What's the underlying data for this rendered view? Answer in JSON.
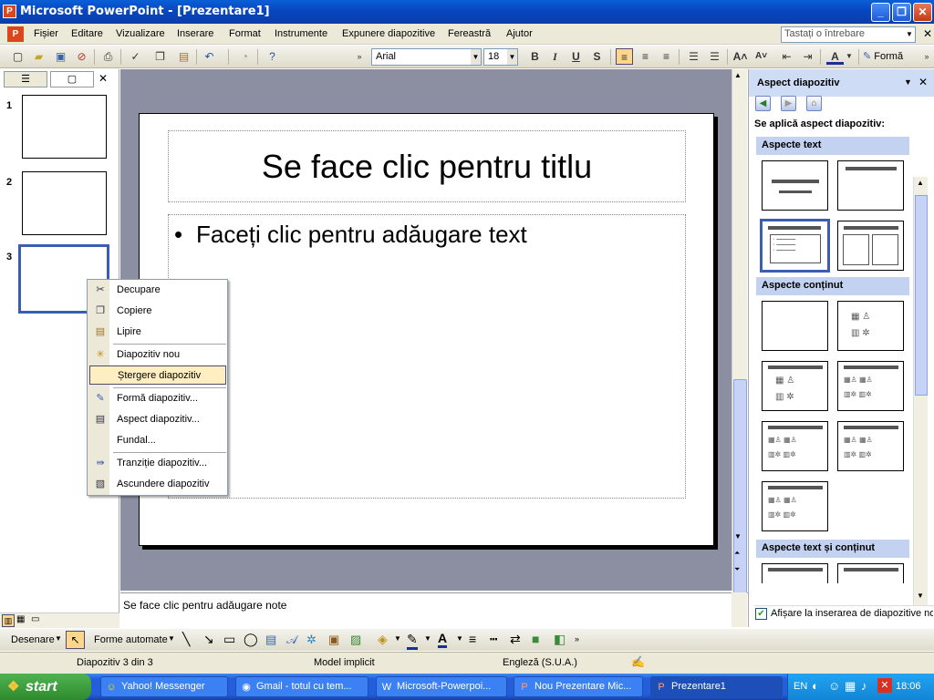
{
  "window": {
    "title": "Microsoft PowerPoint - [Prezentare1]",
    "app_icon": "P"
  },
  "menu": {
    "items": [
      "Fișier",
      "Editare",
      "Vizualizare",
      "Inserare",
      "Format",
      "Instrumente",
      "Expunere diapozitive",
      "Fereastră",
      "Ajutor"
    ],
    "ask_placeholder": "Tastați o întrebare"
  },
  "toolbar": {
    "font": "Arial",
    "size": "18",
    "bold": "B",
    "italic": "I",
    "underline": "U",
    "shadow": "S",
    "design_label": "Formă"
  },
  "slides_pane": {
    "slide_numbers": [
      "1",
      "2",
      "3"
    ]
  },
  "slide": {
    "title_placeholder": "Se face clic pentru titlu",
    "body_placeholder": "Faceți clic pentru adăugare text"
  },
  "notes": {
    "placeholder": "Se face clic pentru adăugare note"
  },
  "context_menu": {
    "items": [
      "Decupare",
      "Copiere",
      "Lipire",
      "Diapozitiv nou",
      "Ștergere diapozitiv",
      "Formă diapozitiv...",
      "Aspect diapozitiv...",
      "Fundal...",
      "Tranziție diapozitiv...",
      "Ascundere diapozitiv"
    ],
    "highlighted": "Ștergere diapozitiv"
  },
  "task_pane": {
    "title": "Aspect diapozitiv",
    "apply_label": "Se aplică aspect diapozitiv:",
    "sections": [
      "Aspecte text",
      "Aspecte conținut",
      "Aspecte text și conținut"
    ],
    "show_checkbox_label": "Afișare la inserarea de diapozitive noi"
  },
  "drawing_toolbar": {
    "draw_label": "Desenare",
    "autoshapes_label": "Forme automate"
  },
  "status": {
    "slide_info": "Diapozitiv 3 din 3",
    "design": "Model implicit",
    "language": "Engleză (S.U.A.)"
  },
  "taskbar": {
    "start_label": "start",
    "tasks": [
      "Yahoo! Messenger",
      "Gmail - totul cu tem...",
      "Microsoft-Powerpoi...",
      "Nou Prezentare Mic...",
      "Prezentare1"
    ],
    "lang": "EN",
    "clock": "18:06"
  },
  "colors": {
    "titlebar": "#0a5fd6",
    "highlight": "#ffeec2",
    "workspace": "#8c8fa2"
  }
}
